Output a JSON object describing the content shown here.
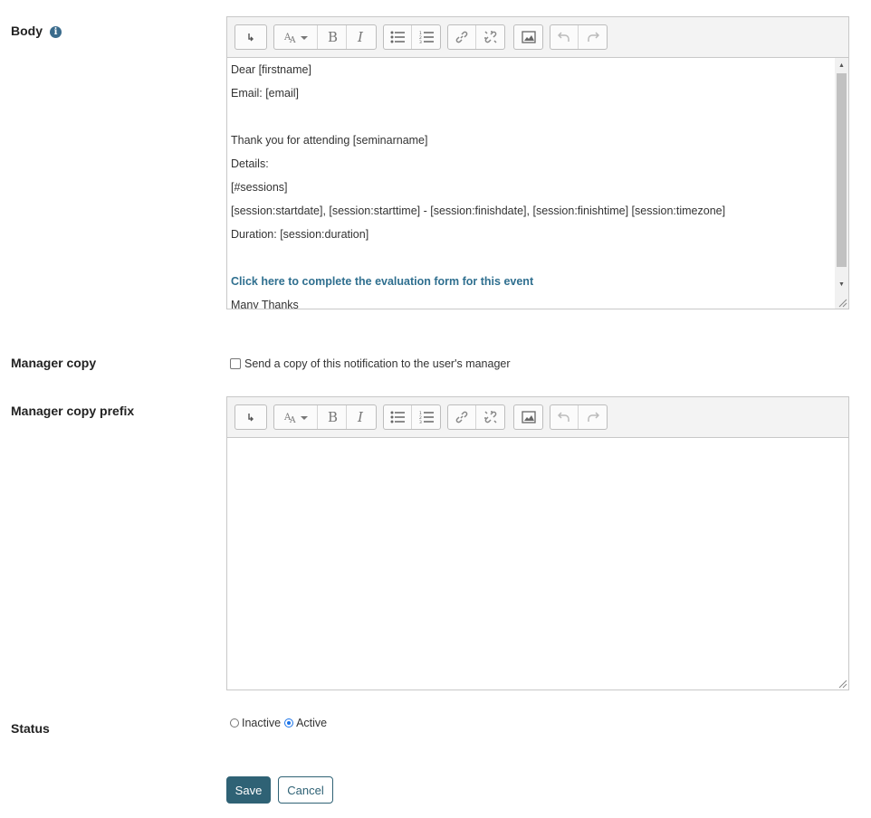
{
  "body_section": {
    "label": "Body",
    "info_icon": "info-icon",
    "lines": [
      "Dear [firstname]",
      "Email: [email]",
      "",
      "Thank you for attending [seminarname]",
      "Details:",
      "[#sessions]",
      "[session:startdate], [session:starttime] - [session:finishdate], [session:finishtime] [session:timezone]",
      "Duration: [session:duration]",
      "",
      "Click here to complete the evaluation form for this event",
      "Many Thanks"
    ]
  },
  "toolbar": {
    "buttons": [
      "expand-toolbar-icon",
      "font-size-icon",
      "bold-icon",
      "italic-icon",
      "bullet-list-icon",
      "numbered-list-icon",
      "link-icon",
      "unlink-icon",
      "image-icon",
      "undo-icon",
      "redo-icon"
    ]
  },
  "manager_copy": {
    "label": "Manager copy",
    "checkbox_label": "Send a copy of this notification to the user's manager",
    "checked": false
  },
  "manager_copy_prefix": {
    "label": "Manager copy prefix",
    "value": ""
  },
  "status": {
    "label": "Status",
    "options": [
      "Inactive",
      "Active"
    ],
    "selected": "Active"
  },
  "actions": {
    "save_label": "Save",
    "cancel_label": "Cancel"
  },
  "colors": {
    "primary": "#2f6275",
    "link": "#2f6f8f",
    "radio_selected": "#1a73e8"
  }
}
